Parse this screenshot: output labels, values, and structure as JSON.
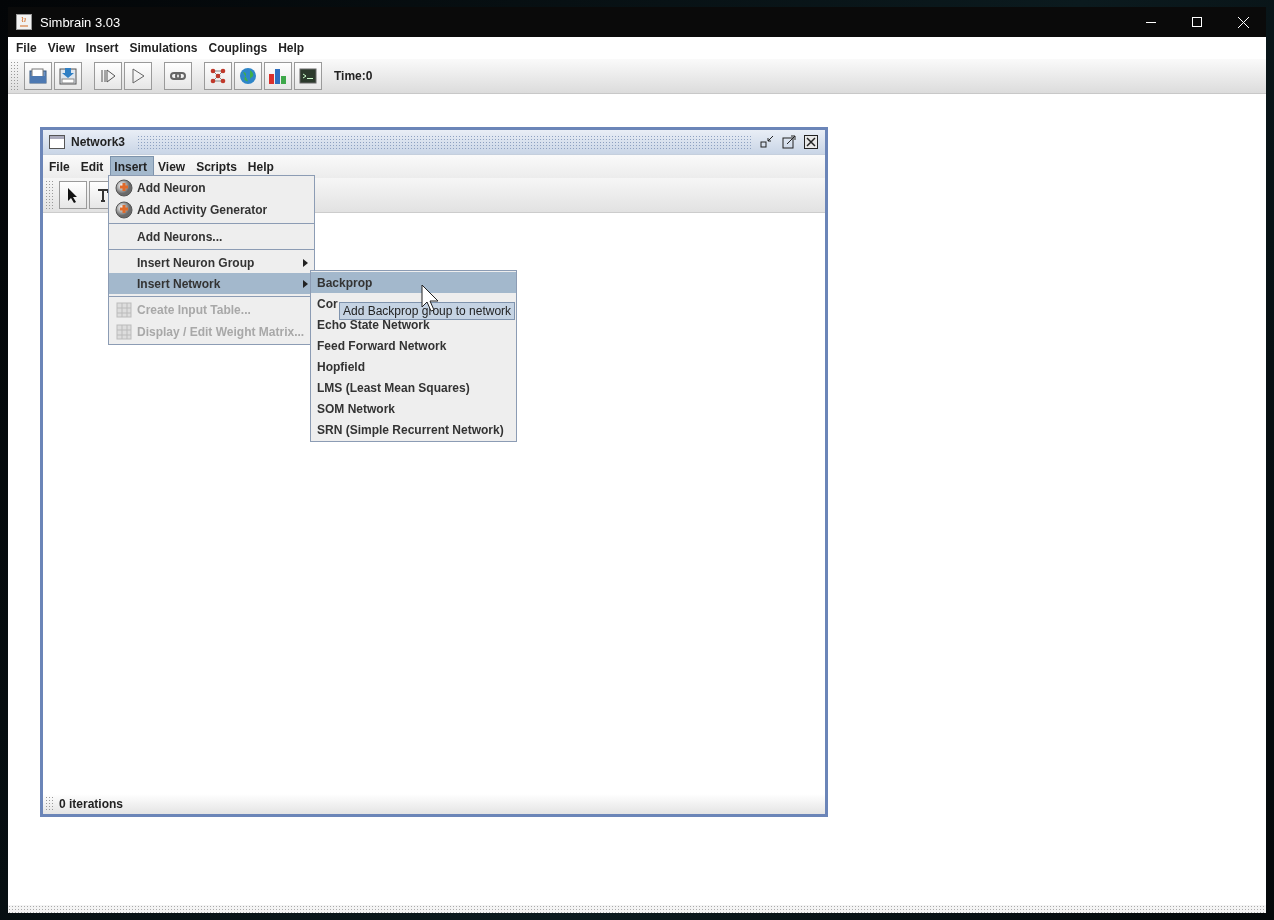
{
  "window": {
    "title": "Simbrain 3.03"
  },
  "menu_bar": [
    {
      "label": "File"
    },
    {
      "label": "View"
    },
    {
      "label": "Insert"
    },
    {
      "label": "Simulations"
    },
    {
      "label": "Couplings"
    },
    {
      "label": "Help"
    }
  ],
  "toolbar": {
    "tools": [
      {
        "kind": "open"
      },
      {
        "kind": "save"
      },
      {
        "kind": "sep"
      },
      {
        "kind": "step"
      },
      {
        "kind": "play"
      },
      {
        "kind": "sep"
      },
      {
        "kind": "link"
      },
      {
        "kind": "sep"
      },
      {
        "kind": "network"
      },
      {
        "kind": "world"
      },
      {
        "kind": "chart"
      },
      {
        "kind": "console"
      }
    ],
    "time": "Time:0"
  },
  "network_window": {
    "title": "Network3",
    "menu_bar": [
      {
        "label": "File",
        "selected": false
      },
      {
        "label": "Edit",
        "selected": false
      },
      {
        "label": "Insert",
        "selected": true
      },
      {
        "label": "View",
        "selected": false
      },
      {
        "label": "Scripts",
        "selected": false
      },
      {
        "label": "Help",
        "selected": false
      }
    ],
    "status": "0 iterations"
  },
  "insert_menu": {
    "items": [
      {
        "kind": "neuron",
        "label": "Add Neuron",
        "selected": false,
        "disabled": false
      },
      {
        "kind": "neuron",
        "label": "Add Activity Generator",
        "selected": false,
        "disabled": false
      },
      {
        "kind": "separator"
      },
      {
        "kind": "plain",
        "label": "Add Neurons...",
        "selected": false,
        "disabled": false
      },
      {
        "kind": "separator"
      },
      {
        "kind": "submenu",
        "label": "Insert Neuron Group",
        "selected": false,
        "disabled": false
      },
      {
        "kind": "submenu",
        "label": "Insert Network",
        "selected": true,
        "disabled": false
      },
      {
        "kind": "separator"
      },
      {
        "kind": "table",
        "label": "Create Input Table...",
        "selected": false,
        "disabled": true
      },
      {
        "kind": "table",
        "label": "Display / Edit Weight Matrix...",
        "selected": false,
        "disabled": true
      }
    ]
  },
  "network_submenu": {
    "items": [
      {
        "label": "Backprop",
        "selected": true
      },
      {
        "label": "Cor",
        "selected": false
      },
      {
        "label": "Echo State Network",
        "selected": false
      },
      {
        "label": "Feed Forward Network",
        "selected": false
      },
      {
        "label": "Hopfield",
        "selected": false
      },
      {
        "label": "LMS (Least Mean Squares)",
        "selected": false
      },
      {
        "label": "SOM Network",
        "selected": false
      },
      {
        "label": "SRN (Simple Recurrent Network)",
        "selected": false
      }
    ]
  },
  "tooltip": "Add Backprop group to network"
}
